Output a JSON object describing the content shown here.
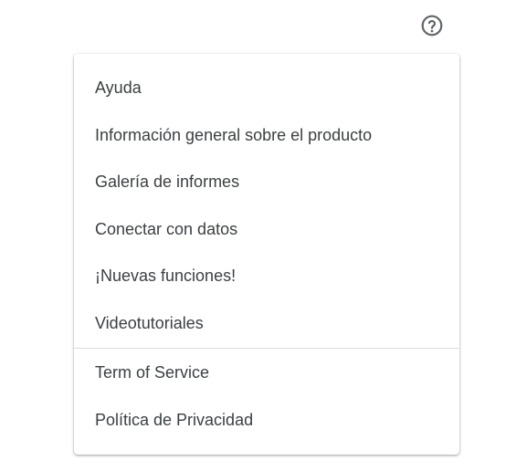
{
  "help_button": {
    "icon": "help-circle-icon"
  },
  "menu": {
    "items": [
      {
        "label": "Ayuda"
      },
      {
        "label": "Información general sobre el producto"
      },
      {
        "label": "Galería de informes"
      },
      {
        "label": "Conectar con datos"
      },
      {
        "label": "¡Nuevas funciones!"
      },
      {
        "label": "Videotutoriales"
      }
    ],
    "legal_items": [
      {
        "label": "Term of Service"
      },
      {
        "label": "Política de Privacidad"
      }
    ]
  },
  "colors": {
    "text": "#3c4043",
    "icon": "#5f6368",
    "divider": "#dadce0"
  }
}
